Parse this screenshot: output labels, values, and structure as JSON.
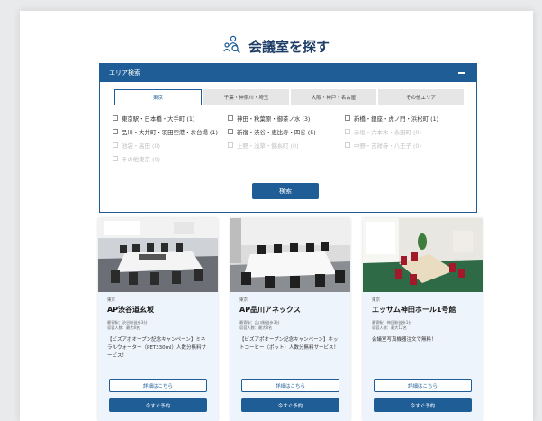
{
  "header": {
    "title": "会議室を探す",
    "icon": "meeting-people-icon"
  },
  "area_panel": {
    "title": "エリア検索",
    "collapse_icon": "minus-icon",
    "tabs": [
      {
        "label": "東京",
        "active": true
      },
      {
        "label": "千葉・神奈川・埼玉",
        "active": false
      },
      {
        "label": "大阪・神戸・名古屋",
        "active": false
      },
      {
        "label": "その他エリア",
        "active": false
      }
    ],
    "areas": [
      {
        "label": "東京駅・日本橋・大手町 (1)",
        "disabled": false
      },
      {
        "label": "神田・秋葉原・御茶ノ水 (3)",
        "disabled": false
      },
      {
        "label": "新橋・銀座・虎ノ門・浜松町 (1)",
        "disabled": false
      },
      {
        "label": "品川・大井町・羽田空港・お台場 (1)",
        "disabled": false
      },
      {
        "label": "新宿・渋谷・恵比寿・四谷 (5)",
        "disabled": false
      },
      {
        "label": "赤坂・六本木・永田町 (0)",
        "disabled": true
      },
      {
        "label": "池袋・高田 (0)",
        "disabled": true
      },
      {
        "label": "上野・浅草・錦糸町 (0)",
        "disabled": true
      },
      {
        "label": "中野・吉祥寺・八王子 (0)",
        "disabled": true
      },
      {
        "label": "その他東京 (0)",
        "disabled": true
      }
    ],
    "search_button": "検索"
  },
  "cards": [
    {
      "region": "東京",
      "name": "AP渋谷道玄坂",
      "access": "最寄駅：渋谷駅徒歩3分",
      "capacity": "収容人数：最大8名",
      "desc": "【ビズアポオープン記念キャンペーン】ミネラルウォーター（PET330ml）人数分無料サービス！",
      "detail": "詳細はこちら",
      "book": "今すぐ予約"
    },
    {
      "region": "東京",
      "name": "AP品川アネックス",
      "access": "最寄駅：品川駅徒歩3分",
      "capacity": "収容人数：最大8名",
      "desc": "【ビズアポオープン記念キャンペーン】ホットコーヒー（ポット）人数分無料サービス！",
      "detail": "詳細はこちら",
      "book": "今すぐ予約"
    },
    {
      "region": "東京",
      "name": "エッサム神田ホール1号館",
      "access": "最寄駅：神田駅徒歩1分",
      "capacity": "収容人数：最大12名",
      "desc": "会議室写真機器注文で無料！",
      "detail": "詳細はこちら",
      "book": "今すぐ予約"
    }
  ]
}
